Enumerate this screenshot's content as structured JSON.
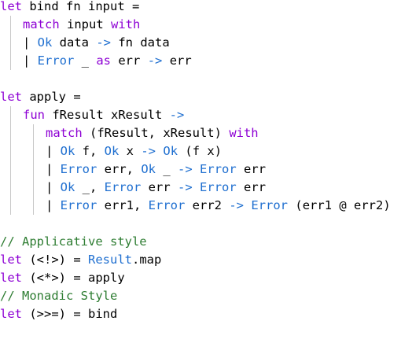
{
  "code_lines": [
    [
      {
        "t": "let",
        "c": "kw"
      },
      {
        "t": " bind fn input =",
        "c": "plain"
      }
    ],
    [
      {
        "t": "match",
        "c": "kw"
      },
      {
        "t": " input ",
        "c": "plain"
      },
      {
        "t": "with",
        "c": "kw"
      }
    ],
    [
      {
        "t": "| ",
        "c": "plain"
      },
      {
        "t": "Ok",
        "c": "ctor"
      },
      {
        "t": " data ",
        "c": "plain"
      },
      {
        "t": "->",
        "c": "op"
      },
      {
        "t": " fn data",
        "c": "plain"
      }
    ],
    [
      {
        "t": "| ",
        "c": "plain"
      },
      {
        "t": "Error",
        "c": "ctor"
      },
      {
        "t": " _ ",
        "c": "plain"
      },
      {
        "t": "as",
        "c": "kw"
      },
      {
        "t": " err ",
        "c": "plain"
      },
      {
        "t": "->",
        "c": "op"
      },
      {
        "t": " err",
        "c": "plain"
      }
    ],
    [],
    [
      {
        "t": "let",
        "c": "kw"
      },
      {
        "t": " apply =",
        "c": "plain"
      }
    ],
    [
      {
        "t": "fun",
        "c": "kw"
      },
      {
        "t": " fResult xResult ",
        "c": "plain"
      },
      {
        "t": "->",
        "c": "op"
      }
    ],
    [
      {
        "t": "match",
        "c": "kw"
      },
      {
        "t": " (fResult, xResult) ",
        "c": "plain"
      },
      {
        "t": "with",
        "c": "kw"
      }
    ],
    [
      {
        "t": "| ",
        "c": "plain"
      },
      {
        "t": "Ok",
        "c": "ctor"
      },
      {
        "t": " f, ",
        "c": "plain"
      },
      {
        "t": "Ok",
        "c": "ctor"
      },
      {
        "t": " x ",
        "c": "plain"
      },
      {
        "t": "->",
        "c": "op"
      },
      {
        "t": " ",
        "c": "plain"
      },
      {
        "t": "Ok",
        "c": "ctor"
      },
      {
        "t": " (f x)",
        "c": "plain"
      }
    ],
    [
      {
        "t": "| ",
        "c": "plain"
      },
      {
        "t": "Error",
        "c": "ctor"
      },
      {
        "t": " err, ",
        "c": "plain"
      },
      {
        "t": "Ok",
        "c": "ctor"
      },
      {
        "t": " _ ",
        "c": "plain"
      },
      {
        "t": "->",
        "c": "op"
      },
      {
        "t": " ",
        "c": "plain"
      },
      {
        "t": "Error",
        "c": "ctor"
      },
      {
        "t": " err",
        "c": "plain"
      }
    ],
    [
      {
        "t": "| ",
        "c": "plain"
      },
      {
        "t": "Ok",
        "c": "ctor"
      },
      {
        "t": " _, ",
        "c": "plain"
      },
      {
        "t": "Error",
        "c": "ctor"
      },
      {
        "t": " err ",
        "c": "plain"
      },
      {
        "t": "->",
        "c": "op"
      },
      {
        "t": " ",
        "c": "plain"
      },
      {
        "t": "Error",
        "c": "ctor"
      },
      {
        "t": " err",
        "c": "plain"
      }
    ],
    [
      {
        "t": "| ",
        "c": "plain"
      },
      {
        "t": "Error",
        "c": "ctor"
      },
      {
        "t": " err1, ",
        "c": "plain"
      },
      {
        "t": "Error",
        "c": "ctor"
      },
      {
        "t": " err2 ",
        "c": "plain"
      },
      {
        "t": "->",
        "c": "op"
      },
      {
        "t": " ",
        "c": "plain"
      },
      {
        "t": "Error",
        "c": "ctor"
      },
      {
        "t": " (err1 @ err2)",
        "c": "plain"
      }
    ],
    [],
    [
      {
        "t": "// Applicative style",
        "c": "cm"
      }
    ],
    [
      {
        "t": "let",
        "c": "kw"
      },
      {
        "t": " (<!>) = ",
        "c": "plain"
      },
      {
        "t": "Result",
        "c": "ctor"
      },
      {
        "t": ".map",
        "c": "plain"
      }
    ],
    [
      {
        "t": "let",
        "c": "kw"
      },
      {
        "t": " (<*>) = apply",
        "c": "plain"
      }
    ],
    [
      {
        "t": "// Monadic Style",
        "c": "cm"
      }
    ],
    [
      {
        "t": "let",
        "c": "kw"
      },
      {
        "t": " (>>=) = bind",
        "c": "plain"
      }
    ]
  ],
  "colors": {
    "keyword": "#8d00d4",
    "constructor": "#1f6fd0",
    "operator": "#1f6fd0",
    "comment": "#2e7d32",
    "plain": "#000000",
    "indent_guide": "#c8c8c8",
    "background": "#ffffff"
  }
}
